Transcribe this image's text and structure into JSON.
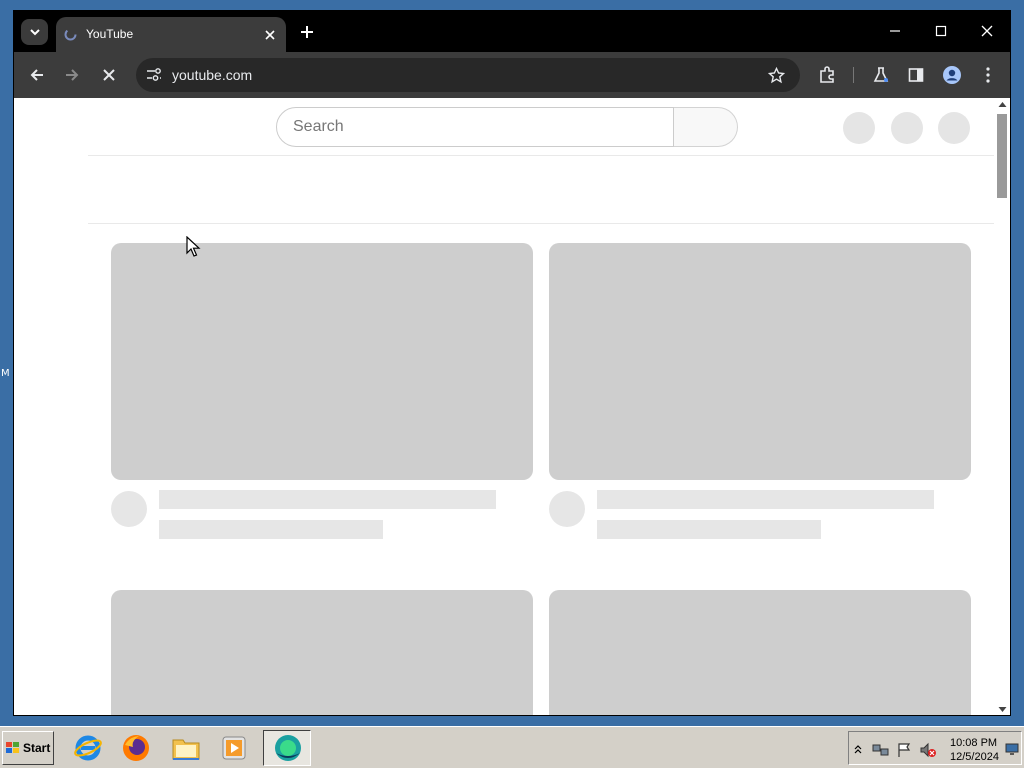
{
  "desktop": {
    "edge_letter": "M"
  },
  "browser": {
    "tab": {
      "title": "YouTube"
    },
    "address": {
      "url": "youtube.com"
    }
  },
  "page": {
    "search": {
      "placeholder": "Search"
    }
  },
  "taskbar": {
    "start_label": "Start",
    "clock": {
      "time": "10:08 PM",
      "date": "12/5/2024"
    }
  },
  "colors": {
    "chrome_dark": "#3c3c3c",
    "skeleton": "#cecece",
    "desktop": "#3a6ea5",
    "taskbar": "#d4d0c8"
  }
}
